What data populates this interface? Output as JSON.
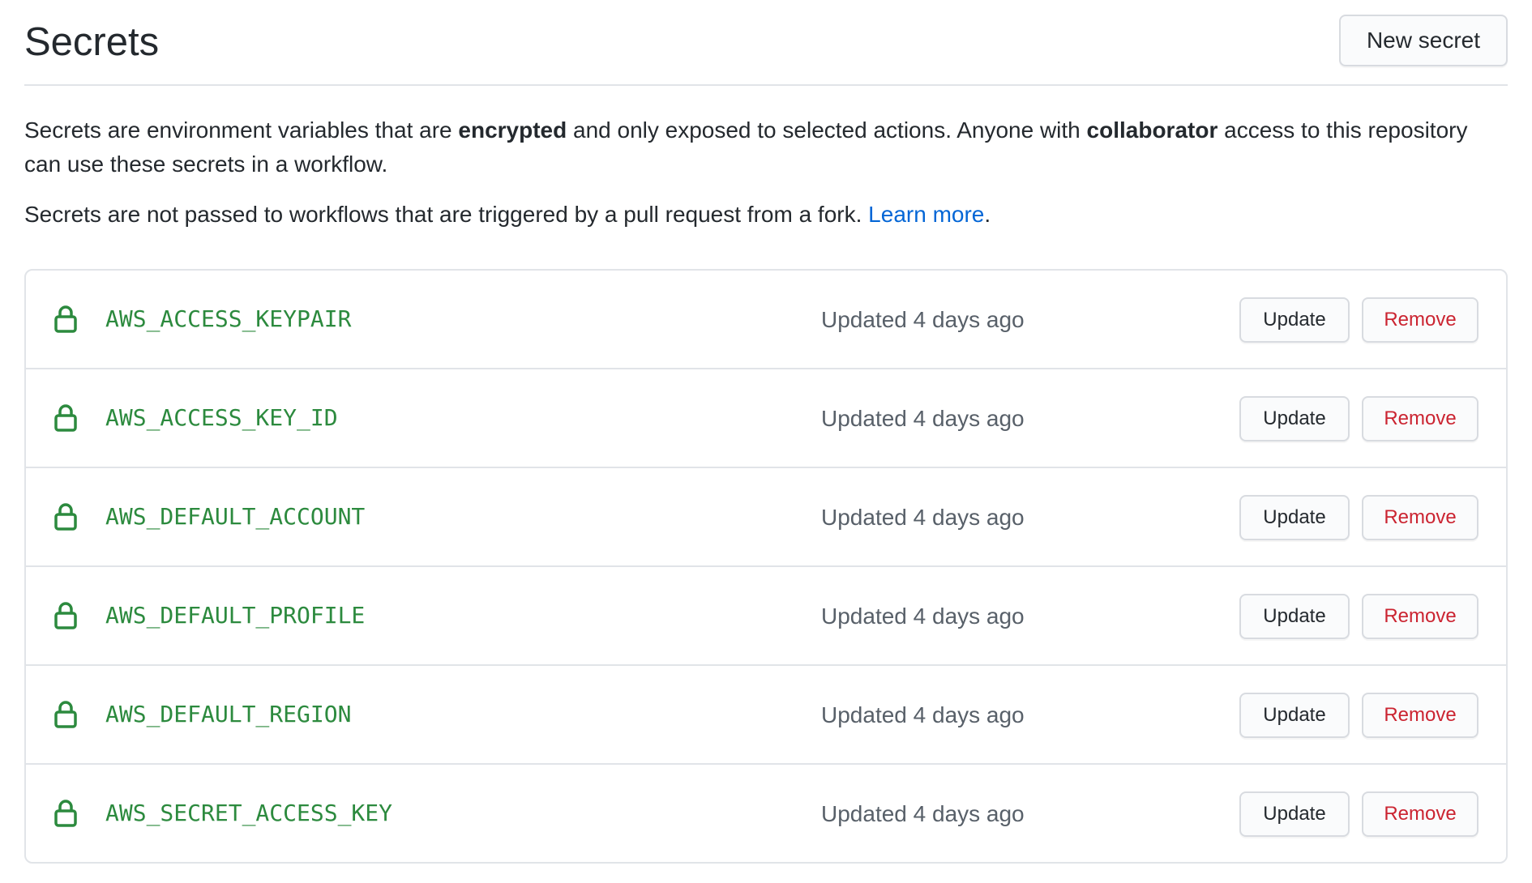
{
  "header": {
    "title": "Secrets",
    "new_secret_label": "New secret"
  },
  "description": {
    "p1_part1": "Secrets are environment variables that are ",
    "p1_bold1": "encrypted",
    "p1_part2": " and only exposed to selected actions. Anyone with ",
    "p1_bold2": "collaborator",
    "p1_part3": " access to this repository can use these secrets in a workflow.",
    "p2_text": "Secrets are not passed to workflows that are triggered by a pull request from a fork. ",
    "p2_link": "Learn more",
    "p2_end": "."
  },
  "icons": {
    "row_icon": "lock-icon"
  },
  "colors": {
    "secret_name": "#2c8a3e",
    "link": "#0366d6",
    "remove": "#cb2431"
  },
  "secrets": [
    {
      "name": "AWS_ACCESS_KEYPAIR",
      "updated": "Updated 4 days ago",
      "update_label": "Update",
      "remove_label": "Remove"
    },
    {
      "name": "AWS_ACCESS_KEY_ID",
      "updated": "Updated 4 days ago",
      "update_label": "Update",
      "remove_label": "Remove"
    },
    {
      "name": "AWS_DEFAULT_ACCOUNT",
      "updated": "Updated 4 days ago",
      "update_label": "Update",
      "remove_label": "Remove"
    },
    {
      "name": "AWS_DEFAULT_PROFILE",
      "updated": "Updated 4 days ago",
      "update_label": "Update",
      "remove_label": "Remove"
    },
    {
      "name": "AWS_DEFAULT_REGION",
      "updated": "Updated 4 days ago",
      "update_label": "Update",
      "remove_label": "Remove"
    },
    {
      "name": "AWS_SECRET_ACCESS_KEY",
      "updated": "Updated 4 days ago",
      "update_label": "Update",
      "remove_label": "Remove"
    }
  ]
}
